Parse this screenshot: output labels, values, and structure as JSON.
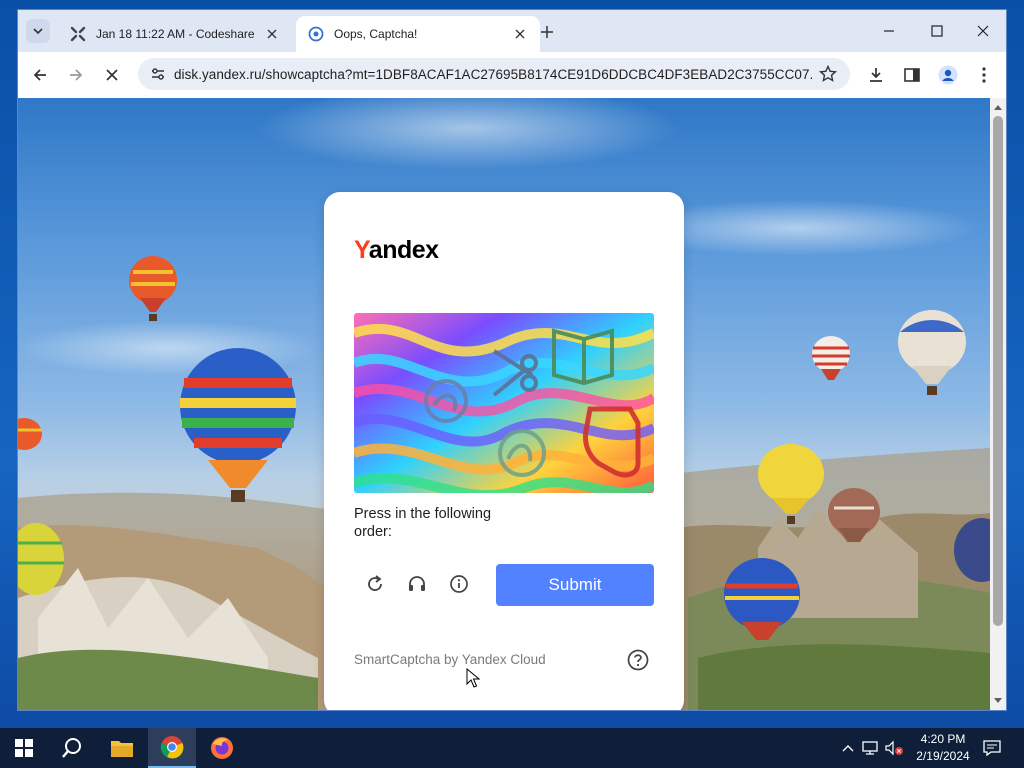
{
  "browser": {
    "tabs": [
      {
        "title": "Jan 18 11:22 AM - Codeshare",
        "active": false,
        "icon": "codeshare-icon"
      },
      {
        "title": "Oops, Captcha!",
        "active": true,
        "icon": "yandex-captcha-icon"
      }
    ],
    "url": "disk.yandex.ru/showcaptcha?mt=1DBF8ACAF1AC27695B8174CE91D6DDCBC4DF3EBAD2C3755CC07...",
    "accent": "#dfe7f5"
  },
  "captcha": {
    "logo_first": "Y",
    "logo_rest": "andex",
    "instruction": "Press in the following order:",
    "submit_label": "Submit",
    "footer": "SmartCaptcha by Yandex Cloud",
    "submit_color": "#5282ff",
    "logo_accent": "#fc3f1d",
    "controls": [
      "refresh-icon",
      "audio-headphones-icon",
      "info-icon"
    ]
  },
  "taskbar": {
    "time": "4:20 PM",
    "date": "2/19/2024",
    "apps": [
      "start-icon",
      "search-icon",
      "file-explorer-icon",
      "chrome-icon",
      "firefox-icon"
    ]
  }
}
